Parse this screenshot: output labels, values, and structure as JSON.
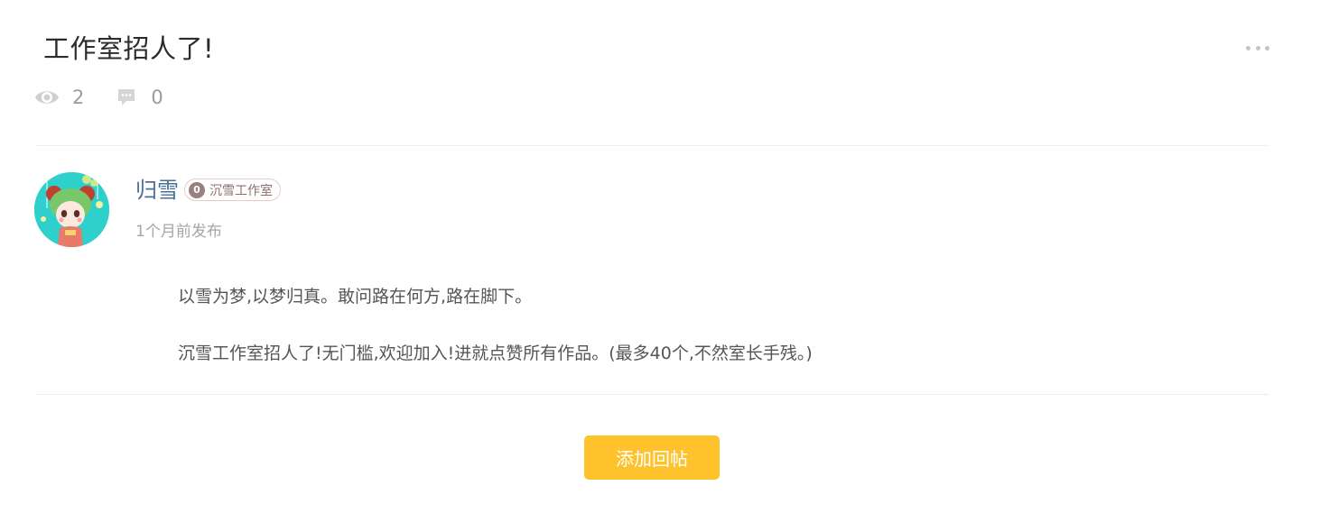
{
  "post": {
    "title": "工作室招人了!",
    "more_icon": "more-dots-icon",
    "stats": {
      "views": "2",
      "views_icon": "eye-icon",
      "comments": "0",
      "comments_icon": "comment-bubble-icon"
    }
  },
  "author": {
    "name": "归雪",
    "avatar_icon": "avatar-image",
    "group": {
      "level": "0",
      "name": "沉雪工作室"
    },
    "post_time": "1个月前发布"
  },
  "content": {
    "paragraphs": [
      "以雪为梦,以梦归真。敢问路在何方,路在脚下。",
      "沉雪工作室招人了!无门槛,欢迎加入!进就点赞所有作品。(最多40个,不然室长手残。)"
    ]
  },
  "actions": {
    "reply_label": "添加回帖"
  },
  "colors": {
    "accent": "#fdc22c",
    "author_name": "#4a6f96",
    "badge_border": "#e8c8c8",
    "badge_level_bg": "#9a7f7f"
  }
}
